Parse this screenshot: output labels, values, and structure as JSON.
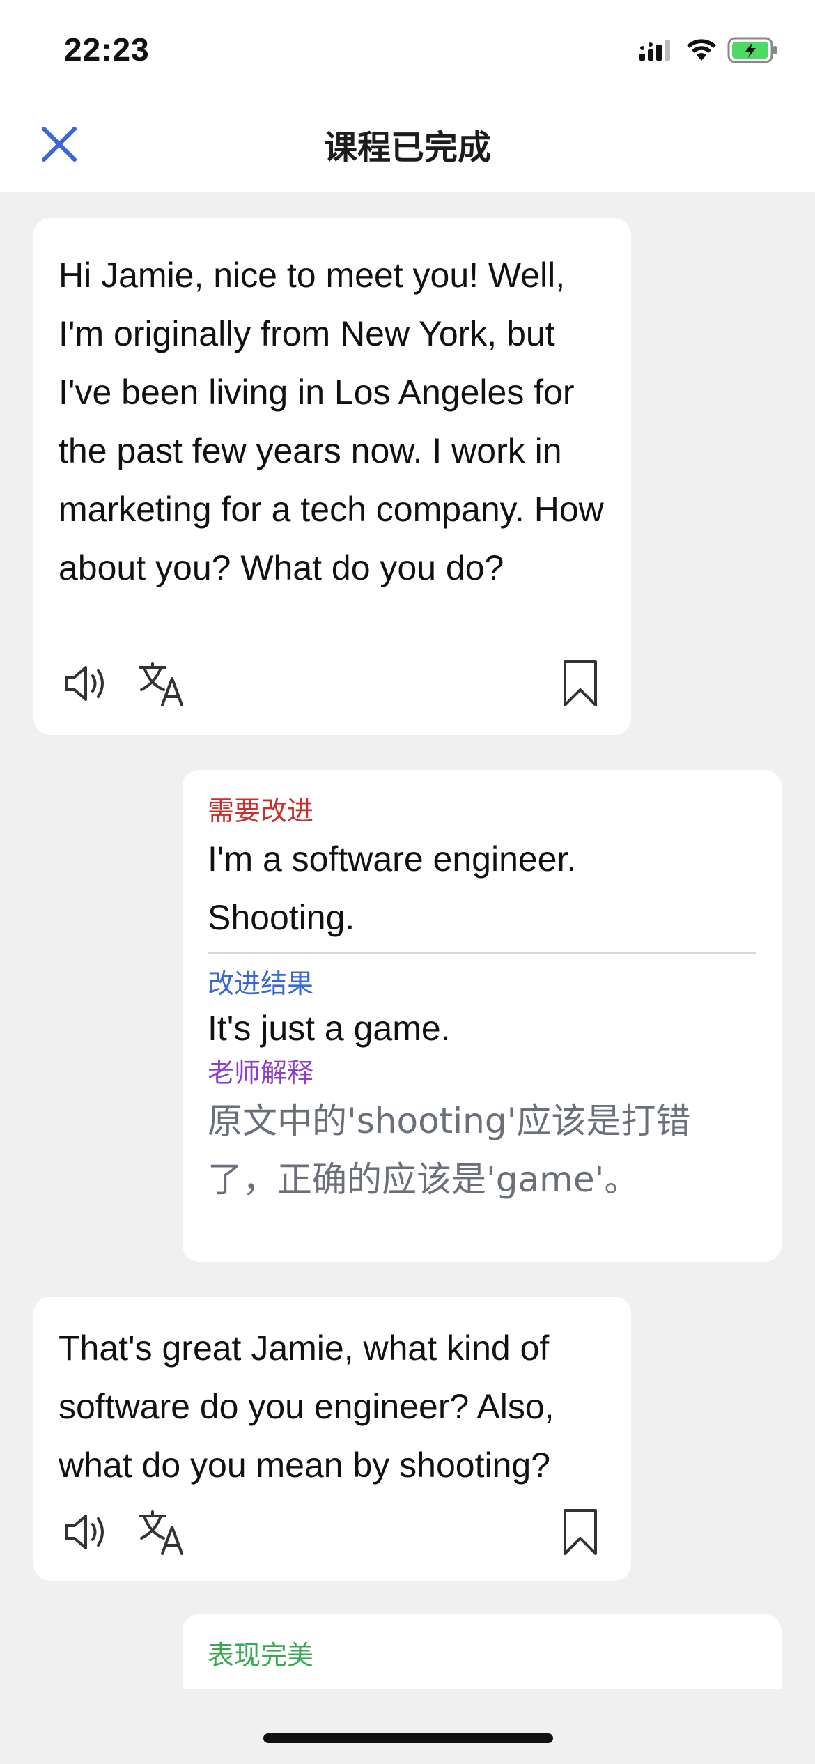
{
  "status_bar": {
    "time": "22:23",
    "icons": [
      "cellular-signal-icon",
      "wifi-icon",
      "battery-charging-icon"
    ]
  },
  "nav": {
    "title": "课程已完成",
    "close_icon": "close-icon"
  },
  "messages": [
    {
      "text": "Hi Jamie, nice to meet you! Well, I'm originally from New York, but I've been living in Los Angeles for the past few years now. I work in marketing for a tech company. How about you? What do you do?",
      "actions": [
        "speaker-icon",
        "translate-icon",
        "bookmark-icon"
      ]
    },
    {
      "text": "That's great Jamie, what kind of software do you engineer? Also, what do you mean by shooting?",
      "actions": [
        "speaker-icon",
        "translate-icon",
        "bookmark-icon"
      ]
    }
  ],
  "feedback": [
    {
      "needs_improvement_label": "需要改进",
      "original_text": "I'm a software engineer. Shooting.",
      "improved_label": "改进结果",
      "improved_text": "It's just a game.",
      "teacher_label": "老师解释",
      "teacher_text": "原文中的'shooting'应该是打错了，正确的应该是'game'。"
    },
    {
      "status_label": "表现完美"
    }
  ],
  "colors": {
    "accent_blue": "#3a66d6",
    "needs_improvement": "#c9302c",
    "teacher": "#8b3fd1",
    "perfect": "#38a852",
    "battery": "#4cd964"
  }
}
